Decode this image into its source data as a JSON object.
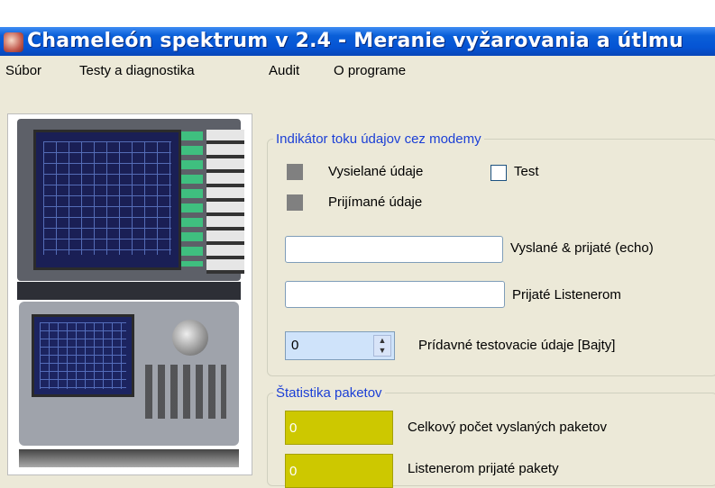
{
  "window": {
    "title": "Chameleón spektrum v 2.4 - Meranie vyžarovania a útlmu"
  },
  "menu": [
    {
      "label": "Súbor"
    },
    {
      "label": "Testy a diagnostika"
    },
    {
      "label": "Audit"
    },
    {
      "label": "O programe"
    }
  ],
  "modem_group": {
    "title": "Indikátor toku údajov cez modemy",
    "sent_label": "Vysielané údaje",
    "received_label": "Prijímané údaje",
    "test_checkbox": {
      "label": "Test",
      "checked": false
    },
    "echo_field": {
      "value": "",
      "label": "Vyslané & prijaté (echo)"
    },
    "listener_field": {
      "value": "",
      "label": "Prijaté Listenerom"
    },
    "extra_bytes": {
      "value": "0",
      "label": "Prídavné testovacie údaje [Bajty]"
    },
    "indicator_color": "#808080"
  },
  "stats_group": {
    "title": "Štatistika paketov",
    "sent_packets": {
      "value": "0",
      "label": "Celkový počet vyslaných paketov"
    },
    "listener_packets": {
      "value": "0",
      "label": "Listenerom prijaté pakety"
    },
    "box_color": "#cdc800"
  },
  "colors": {
    "titlebar": "#0554d4",
    "group_title": "#1b3fd6",
    "background": "#ece9d8"
  }
}
